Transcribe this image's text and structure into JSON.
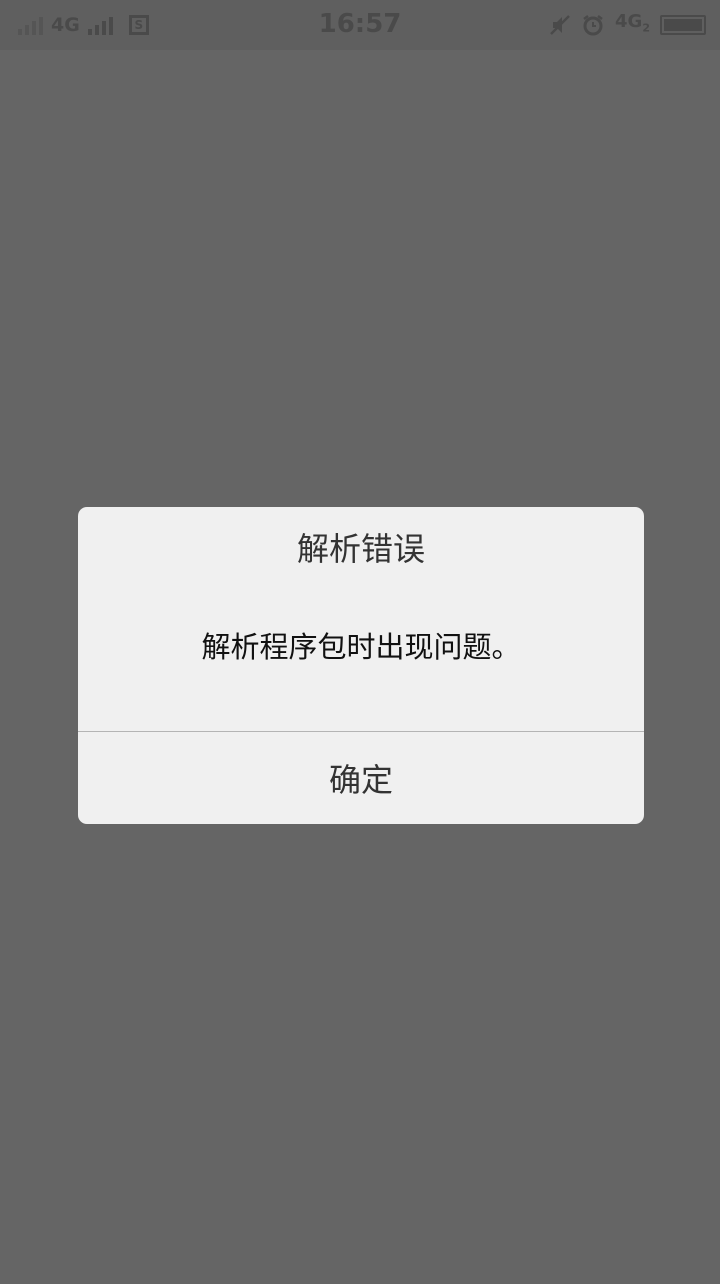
{
  "status_bar": {
    "time": "16:57",
    "network_1": "4G",
    "network_2": "4G",
    "network_2_sub": "2",
    "sim_label": "S",
    "icons": [
      "signal-bars-icon",
      "signal-bars-icon",
      "sim-card-icon",
      "mute-icon",
      "alarm-icon",
      "battery-icon"
    ]
  },
  "dialog": {
    "title": "解析错误",
    "message": "解析程序包时出现问题。",
    "confirm_label": "确定"
  },
  "colors": {
    "background": "#656565",
    "dialog_background": "#f0f0f0",
    "divider": "#b4b4b4"
  }
}
